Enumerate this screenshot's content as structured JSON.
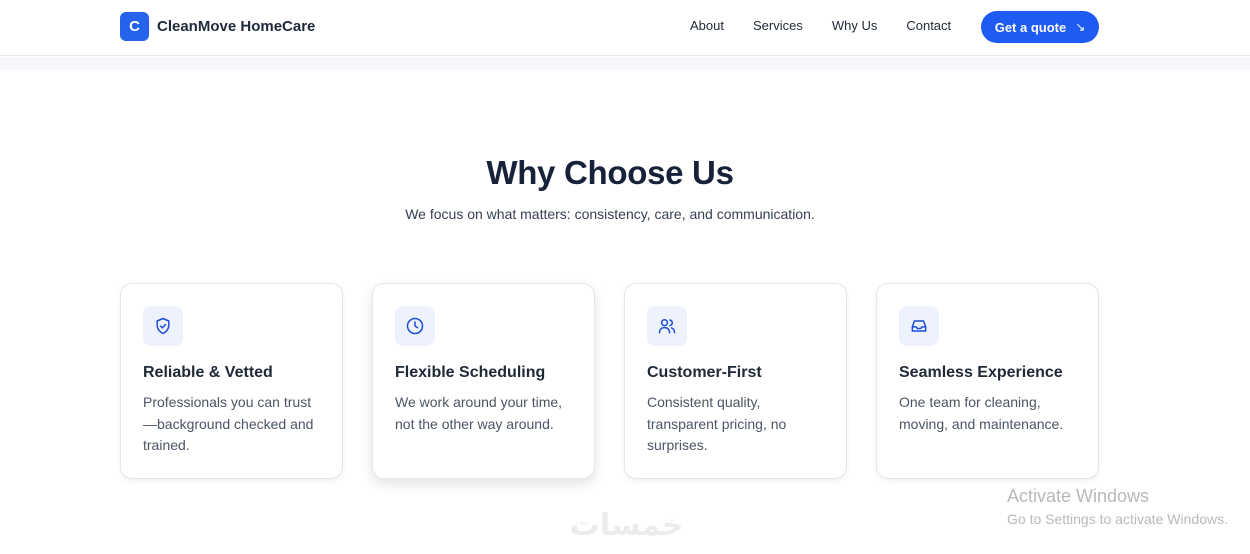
{
  "navbar": {
    "brand_letter": "C",
    "brand_name": "CleanMove HomeCare",
    "links": [
      "About",
      "Services",
      "Why Us",
      "Contact"
    ],
    "cta_label": "Get a quote",
    "cta_icon": "arrow-down-right-icon"
  },
  "section": {
    "title": "Why Choose Us",
    "subtitle": "We focus on what matters: consistency, care, and communication."
  },
  "cards": [
    {
      "icon": "shield-check-icon",
      "title": "Reliable & Vetted",
      "text": "Professionals you can trust—background checked and trained."
    },
    {
      "icon": "clock-icon",
      "title": "Flexible Scheduling",
      "text": "We work around your time, not the other way around."
    },
    {
      "icon": "users-icon",
      "title": "Customer-First",
      "text": "Consistent quality, transparent pricing, no surprises."
    },
    {
      "icon": "inbox-icon",
      "title": "Seamless Experience",
      "text": "One team for cleaning, moving, and maintenance."
    }
  ],
  "overlay": {
    "activate_title": "Activate Windows",
    "activate_sub": "Go to Settings to activate Windows.",
    "watermark": "خمسات"
  },
  "colors": {
    "accent": "#1d5bf2",
    "icon_tile": "#edf2fd",
    "heading": "#16213a"
  }
}
